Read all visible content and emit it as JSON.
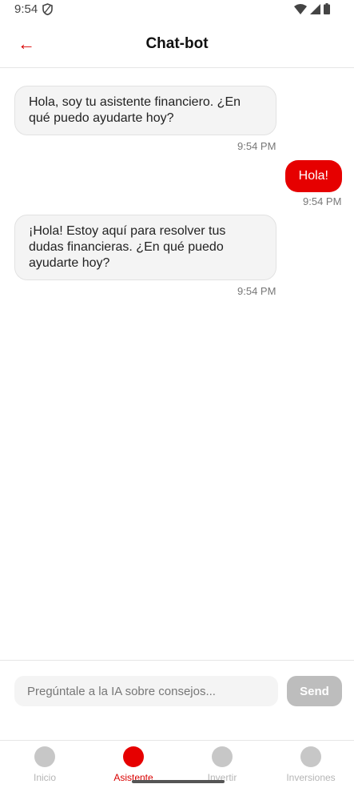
{
  "status_bar": {
    "time": "9:54"
  },
  "header": {
    "back_arrow": "←",
    "title": "Chat-bot"
  },
  "messages": [
    {
      "sender": "bot",
      "text": "Hola, soy tu asistente financiero. ¿En qué puedo ayudarte hoy?",
      "time": "9:54 PM"
    },
    {
      "sender": "user",
      "text": "Hola!",
      "time": "9:54 PM"
    },
    {
      "sender": "bot",
      "text": "¡Hola! Estoy aquí para resolver tus dudas financieras. ¿En qué puedo ayudarte hoy?",
      "time": "9:54 PM"
    }
  ],
  "input": {
    "placeholder": "Pregúntale a la IA sobre consejos...",
    "value": "",
    "send_label": "Send"
  },
  "nav": {
    "items": [
      {
        "label": "Inicio",
        "active": false
      },
      {
        "label": "Asistente",
        "active": true
      },
      {
        "label": "Invertir",
        "active": false
      },
      {
        "label": "Inversiones",
        "active": false
      }
    ]
  },
  "colors": {
    "accent": "#e60000",
    "inactive": "#c7c7c7"
  },
  "icons": {
    "status": [
      "shield-icon",
      "wifi-icon",
      "cellular-signal-icon",
      "battery-icon"
    ]
  }
}
